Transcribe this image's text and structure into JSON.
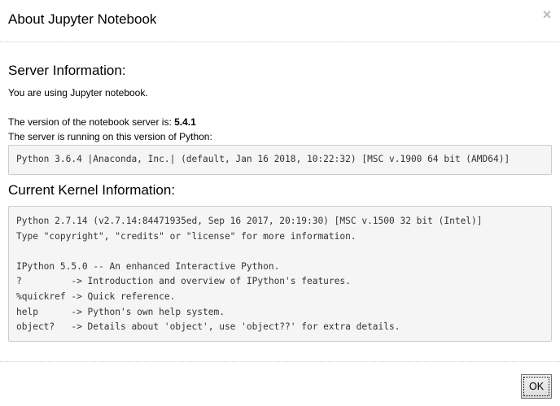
{
  "dialog": {
    "title": "About Jupyter Notebook",
    "close_glyph": "×"
  },
  "server": {
    "heading": "Server Information:",
    "using_text": "You are using Jupyter notebook.",
    "version_prefix": "The version of the notebook server is: ",
    "version": "5.4.1",
    "python_label": "The server is running on this version of Python:",
    "python_version": "Python 3.6.4 |Anaconda, Inc.| (default, Jan 16 2018, 10:22:32) [MSC v.1900 64 bit (AMD64)]"
  },
  "kernel": {
    "heading": "Current Kernel Information:",
    "lines": [
      "Python 2.7.14 (v2.7.14:84471935ed, Sep 16 2017, 20:19:30) [MSC v.1500 32 bit (Intel)]",
      "Type \"copyright\", \"credits\" or \"license\" for more information.",
      "",
      "IPython 5.5.0 -- An enhanced Interactive Python.",
      "?         -> Introduction and overview of IPython's features.",
      "%quickref -> Quick reference.",
      "help      -> Python's own help system.",
      "object?   -> Details about 'object', use 'object??' for extra details."
    ]
  },
  "footer": {
    "ok_label": "OK"
  }
}
